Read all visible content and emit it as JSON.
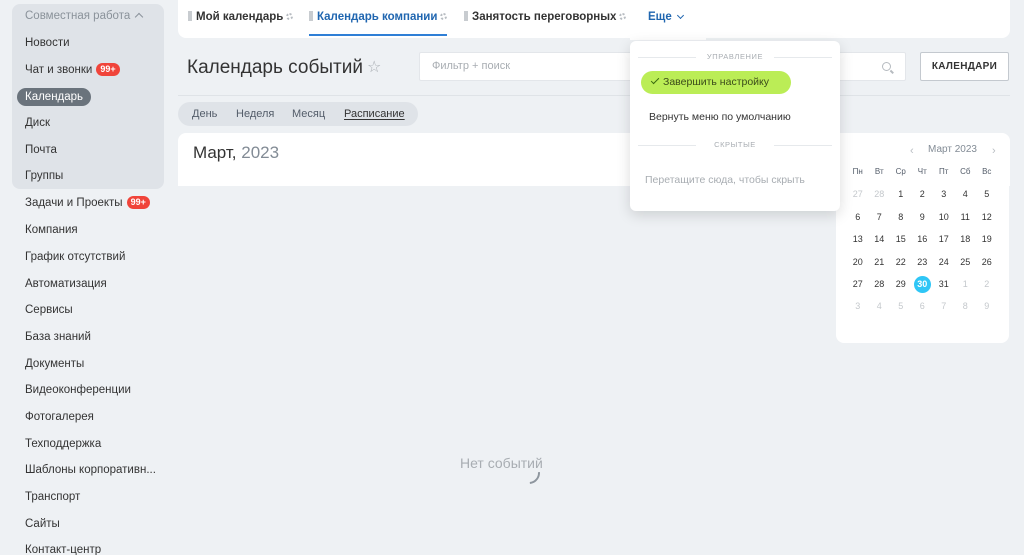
{
  "sidebar": {
    "header": "Совместная работа",
    "items": [
      {
        "label": "Новости"
      },
      {
        "label": "Чат и звонки",
        "badge": "99+"
      },
      {
        "label": "Календарь",
        "active": true
      },
      {
        "label": "Диск"
      },
      {
        "label": "Почта"
      },
      {
        "label": "Группы"
      },
      {
        "label": "Задачи и Проекты",
        "badge": "99+"
      },
      {
        "label": "Компания"
      },
      {
        "label": "График отсутствий"
      },
      {
        "label": "Автоматизация"
      },
      {
        "label": "Сервисы"
      },
      {
        "label": "База знаний"
      },
      {
        "label": "Документы"
      },
      {
        "label": "Видеоконференции"
      },
      {
        "label": "Фотогалерея"
      },
      {
        "label": "Техподдержка"
      },
      {
        "label": "Шаблоны корпоративн..."
      },
      {
        "label": "Транспорт"
      },
      {
        "label": "Сайты"
      },
      {
        "label": "Контакт-центр"
      }
    ]
  },
  "tabs": [
    {
      "label": "Мой календарь"
    },
    {
      "label": "Календарь компании",
      "active": true
    },
    {
      "label": "Занятость переговорных"
    }
  ],
  "more_tab": "Еще",
  "page": {
    "title": "Календарь событий",
    "filter_placeholder": "Фильтр + поиск",
    "calendars_button": "КАЛЕНДАРИ"
  },
  "views": [
    {
      "label": "День"
    },
    {
      "label": "Неделя"
    },
    {
      "label": "Месяц"
    },
    {
      "label": "Расписание",
      "active": true
    }
  ],
  "month": {
    "name": "Март,",
    "year": "2023"
  },
  "empty_text": "Нет событий",
  "mini_calendar": {
    "title": "Март 2023",
    "weekdays": [
      "Пн",
      "Вт",
      "Ср",
      "Чт",
      "Пт",
      "Сб",
      "Вс"
    ],
    "weeks": [
      [
        "27",
        "28",
        "1",
        "2",
        "3",
        "4",
        "5"
      ],
      [
        "6",
        "7",
        "8",
        "9",
        "10",
        "11",
        "12"
      ],
      [
        "13",
        "14",
        "15",
        "16",
        "17",
        "18",
        "19"
      ],
      [
        "20",
        "21",
        "22",
        "23",
        "24",
        "25",
        "26"
      ],
      [
        "27",
        "28",
        "29",
        "30",
        "31",
        "1",
        "2"
      ],
      [
        "3",
        "4",
        "5",
        "6",
        "7",
        "8",
        "9"
      ]
    ],
    "today": "30",
    "colors": {
      "today": "#2fc6f6"
    }
  },
  "dropdown": {
    "section_manage": "УПРАВЛЕНИЕ",
    "finish_setup": "Завершить настройку",
    "reset_menu": "Вернуть меню по умолчанию",
    "section_hidden": "СКРЫТЫЕ",
    "drag_hint": "Перетащите сюда, чтобы скрыть"
  },
  "colors": {
    "accent": "#2066b0",
    "badge": "#f0443a",
    "finish": "#bbed56"
  }
}
